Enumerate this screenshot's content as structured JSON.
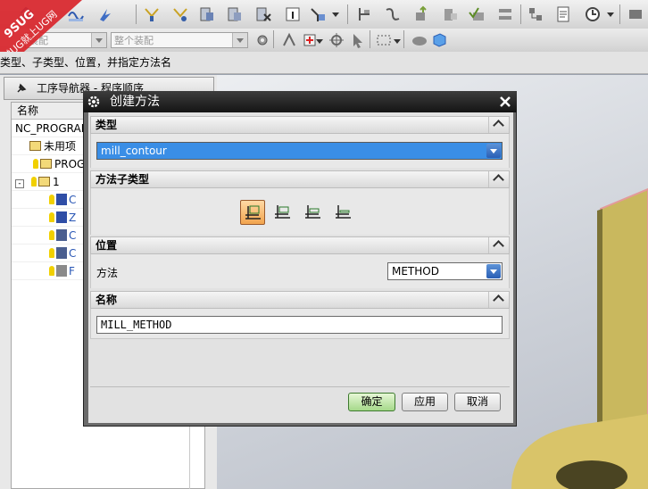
{
  "cue_line": "类型、子类型、位置，并指定方法名",
  "toolbar": {
    "selection_filter_placeholder": "装配",
    "scope_combo": "整个装配"
  },
  "watermark": {
    "line1": "9SUG",
    "line2": "学UG就上UG网"
  },
  "navigator": {
    "title": "工序导航器 - 程序顺序",
    "column_name": "名称",
    "rows": [
      {
        "label": "NC_PROGRAM"
      },
      {
        "label": "未用项"
      },
      {
        "label": "PROG"
      },
      {
        "label": "1"
      },
      {
        "label": "C"
      },
      {
        "label": "Z"
      },
      {
        "label": "C"
      },
      {
        "label": "C"
      },
      {
        "label": "F"
      }
    ]
  },
  "dialog": {
    "title": "创建方法",
    "sections": {
      "type": {
        "label": "类型",
        "value": "mill_contour"
      },
      "subtype": {
        "label": "方法子类型",
        "items": [
          "mill-method-rough",
          "mill-method-semi-finish",
          "mill-method-finish",
          "mill-method-fine"
        ],
        "selected_index": 0
      },
      "location": {
        "label": "位置",
        "method_label": "方法",
        "method_value": "METHOD"
      },
      "name": {
        "label": "名称",
        "value": "MILL_METHOD"
      }
    },
    "buttons": {
      "ok": "确定",
      "apply": "应用",
      "cancel": "取消"
    }
  },
  "colors": {
    "accent_blue": "#3a8ee6",
    "dialog_title": "#141414",
    "model_face": "#d9c469"
  }
}
